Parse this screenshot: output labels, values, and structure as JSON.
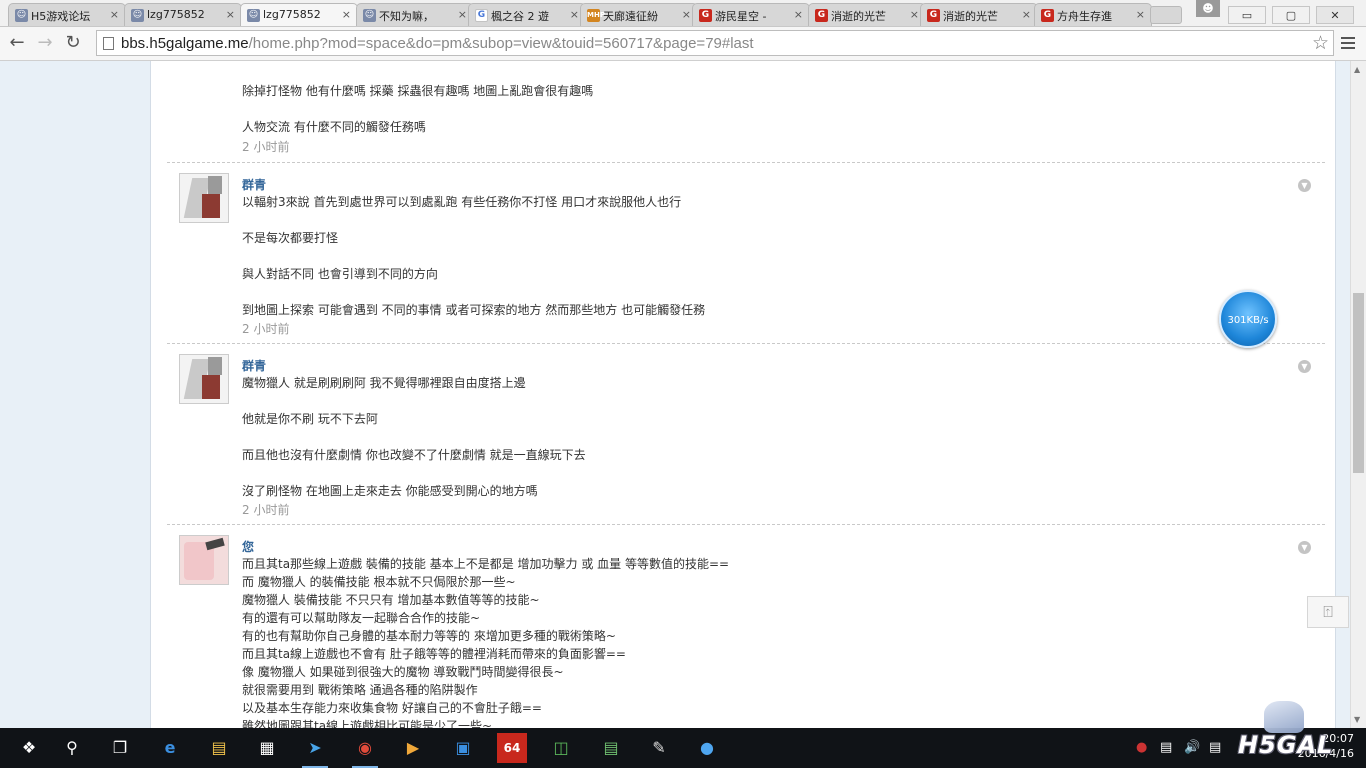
{
  "browser": {
    "tabs": [
      {
        "title": "H5游戏论坛",
        "icon": "avatar-icon",
        "active": false
      },
      {
        "title": "lzg775852",
        "icon": "avatar-icon",
        "active": false
      },
      {
        "title": "lzg775852",
        "icon": "avatar-icon",
        "active": true
      },
      {
        "title": "不知为嘛，",
        "icon": "avatar-icon",
        "active": false
      },
      {
        "title": "楓之谷 2 遊",
        "icon": "google-icon",
        "active": false
      },
      {
        "title": "天廊遠征紛",
        "icon": "mhp-icon",
        "active": false
      },
      {
        "title": "游民星空 -",
        "icon": "gamersky-icon",
        "active": false
      },
      {
        "title": "消逝的光芒",
        "icon": "gamersky-icon",
        "active": false
      },
      {
        "title": "消逝的光芒",
        "icon": "gamersky-icon",
        "active": false
      },
      {
        "title": "方舟生存進",
        "icon": "gamersky-icon",
        "active": false
      }
    ],
    "url_host": "bbs.h5galgame.me",
    "url_path": "/home.php?mod=space&do=pm&subop=view&touid=560717&page=79#last",
    "minimize": "▭",
    "restore": "▢",
    "close": "✕"
  },
  "messages": [
    {
      "author": "",
      "lines": [
        "除掉打怪物  他有什麼嗎  採藥 採蟲很有趣嗎  地圖上亂跑會很有趣嗎",
        "",
        "人物交流  有什麼不同的觸發任務嗎"
      ],
      "time": "2 小时前"
    },
    {
      "author": "群青",
      "lines": [
        "以輻射3來說  首先到處世界可以到處亂跑  有些任務你不打怪  用口才來說服他人也行",
        "",
        "不是每次都要打怪",
        "",
        "與人對話不同  也會引導到不同的方向",
        "",
        "到地圖上探索  可能會遇到 不同的事情   或者可探索的地方  然而那些地方  也可能觸發任務"
      ],
      "time": "2 小时前"
    },
    {
      "author": "群青",
      "lines": [
        "魔物獵人 就是刷刷刷阿  我不覺得哪裡跟自由度搭上邊",
        "",
        "他就是你不刷 玩不下去阿",
        "",
        "而且他也沒有什麼劇情  你也改變不了什麼劇情  就是一直線玩下去",
        "",
        "沒了刷怪物  在地圖上走來走去  你能感受到開心的地方嗎"
      ],
      "time": "2 小时前"
    },
    {
      "author": "您",
      "lines": [
        "而且其ta那些線上遊戲 裝備的技能 基本上不是都是 增加功擊力 或 血量 等等數值的技能==",
        "而 魔物獵人 的裝備技能 根本就不只侷限於那一些~",
        "魔物獵人 裝備技能 不只只有 增加基本數值等等的技能~",
        "有的還有可以幫助隊友一起聯合合作的技能~",
        "有的也有幫助你自己身體的基本耐力等等的 來增加更多種的戰術策略~",
        "而且其ta線上遊戲也不會有 肚子餓等等的體裡消耗而帶來的負面影響==",
        "像 魔物獵人 如果碰到很強大的魔物 導致戰鬥時間變得很長~",
        "就很需要用到 戰術策略 通過各種的陷阱製作",
        "以及基本生存能力來收集食物 好讓自己的不會肚子餓==",
        "雖然地圖跟其ta線上遊戲相比可能是少了一些~"
      ],
      "time": ""
    }
  ],
  "speed_indicator": "301KB/s",
  "back_to_top": "⍐",
  "taskbar": {
    "clock_time": "20:07",
    "clock_date": "2016/4/16",
    "watermark": "H5GAL"
  },
  "colors": {
    "author": "#336699",
    "page_bg": "#e8f0f7",
    "taskbar": "#101317"
  }
}
